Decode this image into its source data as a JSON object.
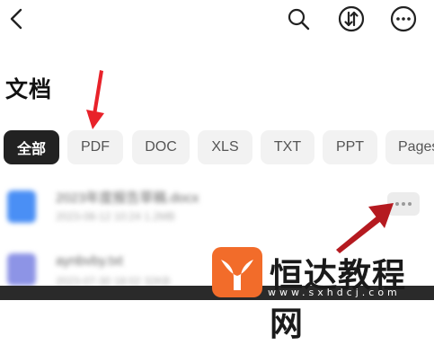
{
  "header": {
    "back_icon": "chevron-left-icon",
    "search_icon": "search-icon",
    "sort_icon": "sort-arrows-icon",
    "more_icon": "more-horizontal-icon"
  },
  "page": {
    "title": "文档"
  },
  "filters": {
    "chips": [
      "全部",
      "PDF",
      "DOC",
      "XLS",
      "TXT",
      "PPT",
      "Pages"
    ],
    "selected": "全部"
  },
  "files": [
    {
      "name": "2023年度报告草稿.docx",
      "meta": "2023-08-12 10:24  1.2MB",
      "icon_color": "#4a8ff5"
    },
    {
      "name": "aynbvby.txt",
      "meta": "2023-07-30 18:02  32KB",
      "icon_color": "#8d94e6"
    }
  ],
  "watermark": {
    "text": "恒达教程网",
    "url": "www.sxhdcj.com",
    "brand_color": "#f26c2a"
  },
  "colors": {
    "annotation_arrow": "#e8222a",
    "chip_active": "#222222",
    "chip_inactive": "#f2f2f2"
  }
}
